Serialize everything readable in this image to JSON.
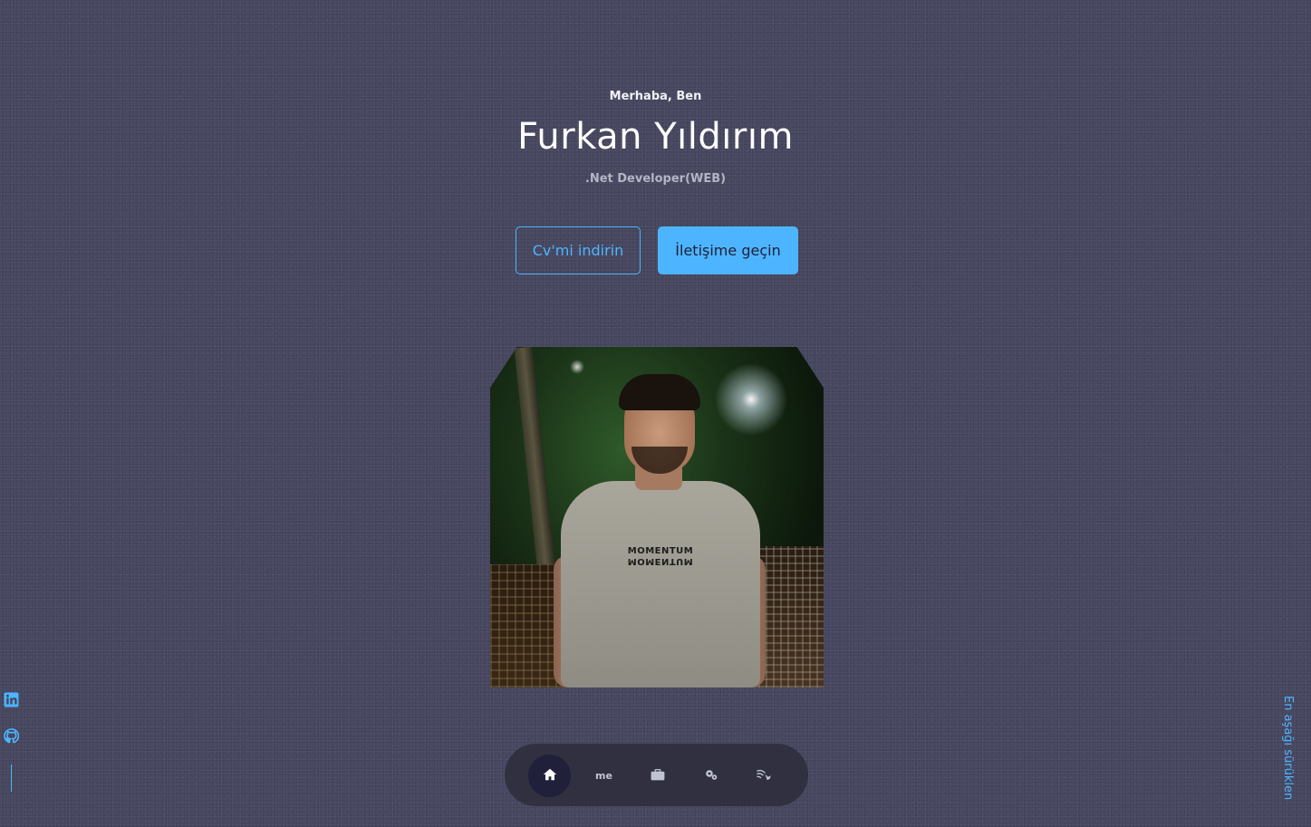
{
  "hero": {
    "greeting": "Merhaba, Ben",
    "name": "Furkan Yıldırım",
    "role": ".Net Developer(WEB)"
  },
  "buttons": {
    "download_cv": "Cv'mi indirin",
    "contact": "İletişime geçin"
  },
  "photo": {
    "shirt_text": "MOMENTUM",
    "shirt_text_mirrored": "MOMENTUM"
  },
  "social": {
    "items": [
      {
        "icon": "linkedin-icon"
      },
      {
        "icon": "github-icon"
      }
    ]
  },
  "scroll_down": {
    "label": "En aşağı sürüklen"
  },
  "nav": {
    "items": [
      {
        "icon": "home-icon",
        "label": "",
        "active": true
      },
      {
        "icon": "about-icon",
        "label": "me",
        "active": false
      },
      {
        "icon": "briefcase-icon",
        "label": "",
        "active": false
      },
      {
        "icon": "gears-icon",
        "label": "",
        "active": false
      },
      {
        "icon": "contact-icon",
        "label": "",
        "active": false
      }
    ]
  },
  "colors": {
    "accent": "#4db5ff",
    "background": "#45455f",
    "nav_active": "#20203a"
  }
}
